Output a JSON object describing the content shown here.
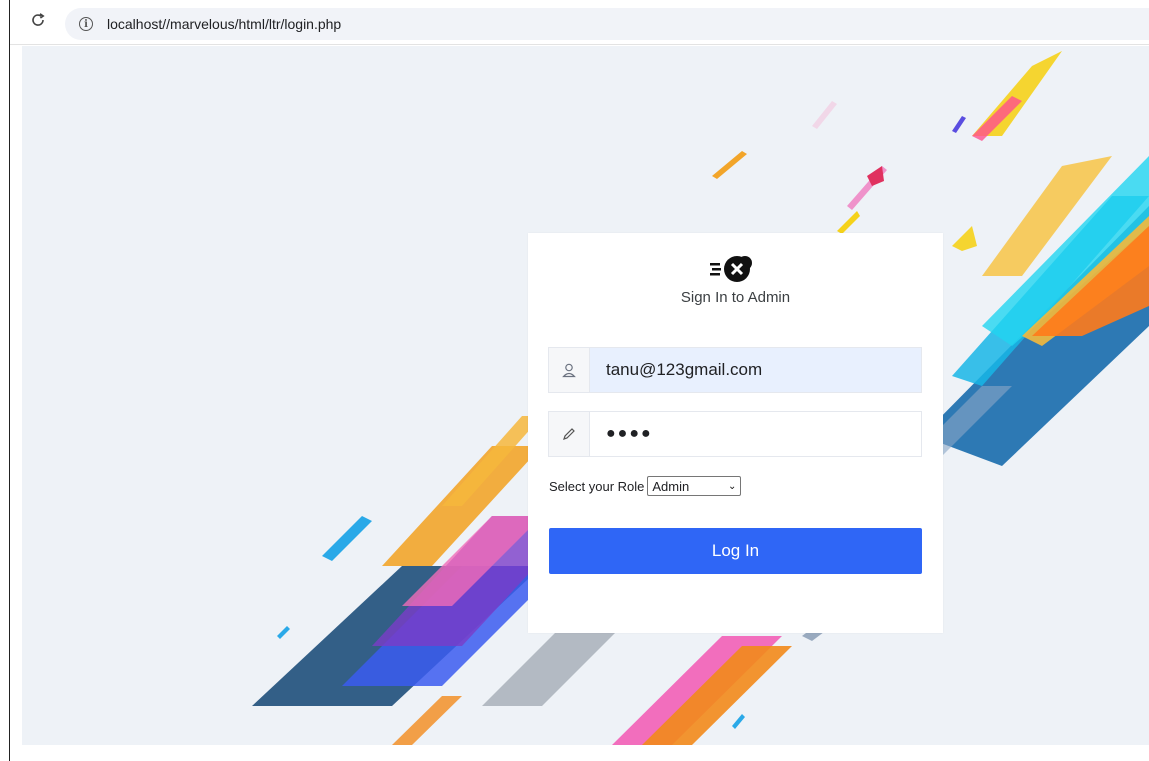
{
  "browser": {
    "url": "localhost//marvelous/html/ltr/login.php",
    "reload_icon": "reload-icon",
    "info_icon": "info-icon"
  },
  "login": {
    "title": "Sign In to Admin",
    "email_value": "tanu@123gmail.com",
    "password_mask": "●●●●",
    "role_label": "Select your Role",
    "role_selected": "Admin",
    "login_button": "Log In",
    "user_icon": "user-icon",
    "pencil_icon": "pencil-icon"
  },
  "colors": {
    "primary_button": "#2f66f6",
    "email_field_bg": "#e8f0fe",
    "background": "#eef2f7"
  }
}
